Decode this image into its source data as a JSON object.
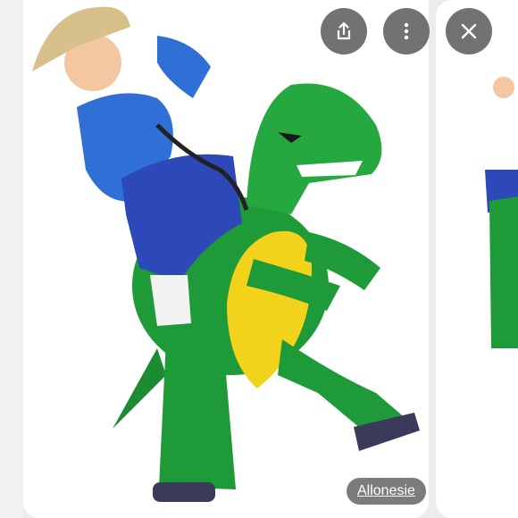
{
  "viewer": {
    "actions": {
      "share_icon": "share-icon",
      "more_icon": "more-vertical-icon",
      "close_icon": "close-icon"
    },
    "source_label": "Allonesie"
  },
  "colors": {
    "overlay_button": "#5f5f5f",
    "dino_green": "#1f9a38",
    "dino_belly": "#f2d21a",
    "shirt_blue": "#2f6fd6",
    "pants_blue": "#2d48b8"
  }
}
